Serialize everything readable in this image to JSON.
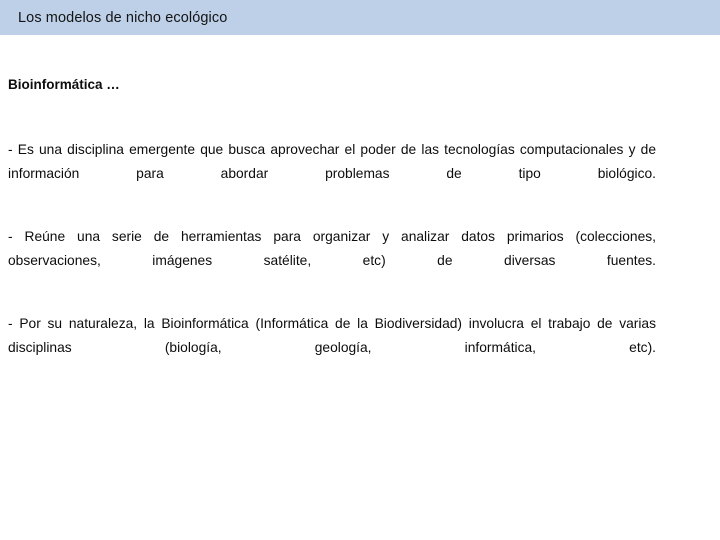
{
  "slide": {
    "title": "Los modelos de nicho ecológico",
    "header_bg": "#bdd0e8",
    "body_bg": "#ffffff",
    "text_color": "#0d0d0d"
  },
  "content": {
    "lead": "Bioinformática …",
    "paragraphs": [
      "- Es una disciplina emergente que busca aprovechar el poder de las tecnologías computacionales y de información para abordar problemas de tipo biológico.",
      "- Reúne una serie de herramientas para organizar y analizar datos primarios (colecciones, observaciones, imágenes satélite, etc) de diversas fuentes.",
      "- Por su naturaleza, la Bioinformática (Informática de la Biodiversidad) involucra el trabajo de varias disciplinas (biología, geología, informática, etc)."
    ]
  }
}
